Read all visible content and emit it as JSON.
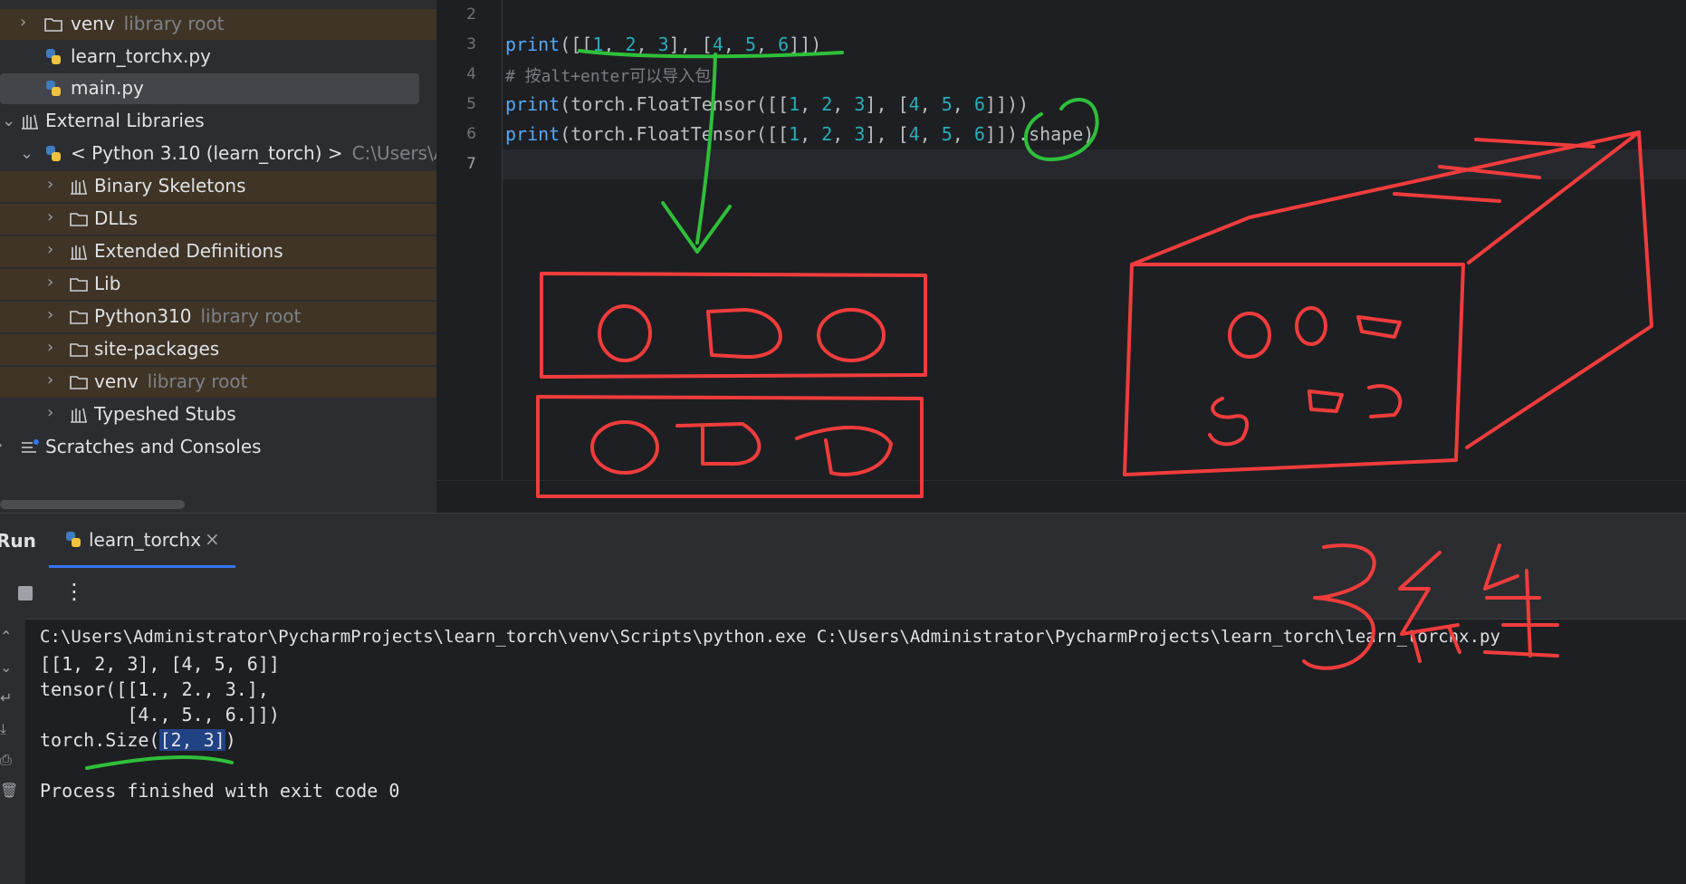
{
  "project_tree": {
    "rows": [
      {
        "label": "venv",
        "hint": "library root"
      },
      {
        "label": "learn_torchx.py"
      },
      {
        "label": "main.py"
      },
      {
        "label": "External Libraries"
      },
      {
        "label": "< Python 3.10 (learn_torch) >",
        "hint": "C:\\Users\\Admi"
      },
      {
        "label": "Binary Skeletons"
      },
      {
        "label": "DLLs"
      },
      {
        "label": "Extended Definitions"
      },
      {
        "label": "Lib"
      },
      {
        "label": "Python310",
        "hint": "library root"
      },
      {
        "label": "site-packages"
      },
      {
        "label": "venv",
        "hint": "library root"
      },
      {
        "label": "Typeshed Stubs"
      },
      {
        "label": "Scratches and Consoles"
      }
    ]
  },
  "editor": {
    "line_numbers": [
      "2",
      "3",
      "4",
      "5",
      "6",
      "7"
    ],
    "lines": {
      "l3": {
        "fn": "print",
        "open": "([[",
        "a": "1",
        "s1": ", ",
        "b": "2",
        "s2": ", ",
        "c": "3",
        "mid": "], [",
        "d": "4",
        "s3": ", ",
        "e": "5",
        "s4": ", ",
        "f": "6",
        "close": "]])"
      },
      "l4": {
        "comment": "# 按alt+enter可以导入包"
      },
      "l5": {
        "fn": "print",
        "pre": "(torch.FloatTensor([[",
        "a": "1",
        "s1": ", ",
        "b": "2",
        "s2": ", ",
        "c": "3",
        "mid": "], [",
        "d": "4",
        "s3": ", ",
        "e": "5",
        "s4": ", ",
        "f": "6",
        "close": "]]))"
      },
      "l6": {
        "fn": "print",
        "pre": "(torch.FloatTensor([[",
        "a": "1",
        "s1": ", ",
        "b": "2",
        "s2": ", ",
        "c": "3",
        "mid": "], [",
        "d": "4",
        "s3": ", ",
        "e": "5",
        "s4": ", ",
        "f": "6",
        "close": "]]).shape)"
      }
    }
  },
  "run_panel": {
    "title": "Run",
    "tab_label": "learn_torchx",
    "tab_close": "×",
    "more_glyph": "⋮",
    "console": {
      "cmd": "C:\\Users\\Administrator\\PycharmProjects\\learn_torch\\venv\\Scripts\\python.exe C:\\Users\\Administrator\\PycharmProjects\\learn_torch\\learn_torchx.py",
      "out1": "[[1, 2, 3], [4, 5, 6]]",
      "out2": "tensor([[1., 2., 3.],",
      "out3": "        [4., 5., 6.]])",
      "out4_prefix": "torch.Size(",
      "out4_highlight": "[2, 3]",
      "out4_suffix": ")",
      "exit": "Process finished with exit code 0"
    }
  },
  "colors": {
    "accent": "#3574f0",
    "annotation_red": "#f03c3c",
    "annotation_green": "#2fbf3a"
  }
}
